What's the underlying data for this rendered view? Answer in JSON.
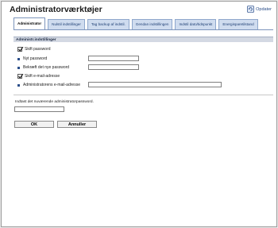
{
  "header": {
    "title": "Administratorværktøjer",
    "update_label": "Opdater"
  },
  "tabs": [
    {
      "label": "Administrator",
      "active": true
    },
    {
      "label": "Nulstil indstillinger",
      "active": false
    },
    {
      "label": "Tag backup af indstil.",
      "active": false
    },
    {
      "label": "Gendan indstillingen",
      "active": false
    },
    {
      "label": "Indstil dato/tidspunkt",
      "active": false
    },
    {
      "label": "Energisparetilstand",
      "active": false
    }
  ],
  "section": {
    "title": "Administr.indstillinger"
  },
  "form": {
    "change_password": {
      "label": "Skift password",
      "checked": true
    },
    "new_password": {
      "label": "Nyt password",
      "value": ""
    },
    "confirm_password": {
      "label": "Bekræft det nye password",
      "value": ""
    },
    "change_email": {
      "label": "Skift e-mail-adresse",
      "checked": true
    },
    "admin_email": {
      "label": "Administratorens e-mail-adresse",
      "value": ""
    }
  },
  "current_password": {
    "label": "Indtast det nuværende administratorpassword.",
    "value": ""
  },
  "buttons": {
    "ok": "OK",
    "cancel": "Annuller"
  },
  "colors": {
    "accent": "#2c4f8a",
    "tab_bg": "#cfdcef",
    "section_bg": "#d4d9e3"
  }
}
